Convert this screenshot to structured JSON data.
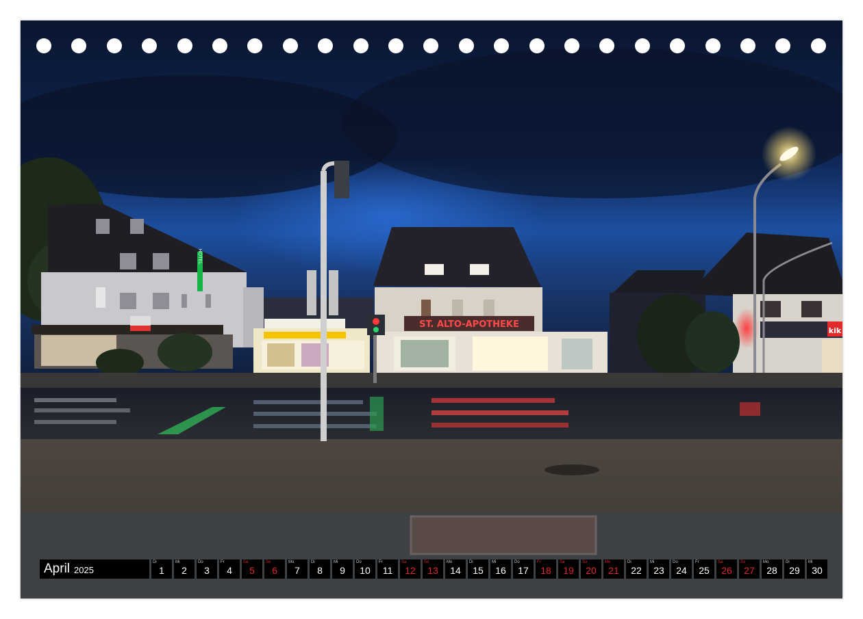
{
  "page": {
    "background": "#ffffff"
  },
  "photo": {
    "signs": {
      "pharmacy": "ST. ALTO-APOTHEKE",
      "hotel": "HOTEL",
      "kik": "kik"
    }
  },
  "binder_holes": {
    "count": 23,
    "color": "#ffffff"
  },
  "calendar": {
    "month": "April",
    "year": "2025",
    "weekend_color": "#e0262d",
    "days": [
      {
        "wd": "Di",
        "d": "1",
        "we": false
      },
      {
        "wd": "Mi",
        "d": "2",
        "we": false
      },
      {
        "wd": "Do",
        "d": "3",
        "we": false
      },
      {
        "wd": "Fr",
        "d": "4",
        "we": false
      },
      {
        "wd": "Sa",
        "d": "5",
        "we": true
      },
      {
        "wd": "So",
        "d": "6",
        "we": true
      },
      {
        "wd": "Mo",
        "d": "7",
        "we": false
      },
      {
        "wd": "Di",
        "d": "8",
        "we": false
      },
      {
        "wd": "Mi",
        "d": "9",
        "we": false
      },
      {
        "wd": "Do",
        "d": "10",
        "we": false
      },
      {
        "wd": "Fr",
        "d": "11",
        "we": false
      },
      {
        "wd": "Sa",
        "d": "12",
        "we": true
      },
      {
        "wd": "So",
        "d": "13",
        "we": true
      },
      {
        "wd": "Mo",
        "d": "14",
        "we": false
      },
      {
        "wd": "Di",
        "d": "15",
        "we": false
      },
      {
        "wd": "Mi",
        "d": "16",
        "we": false
      },
      {
        "wd": "Do",
        "d": "17",
        "we": false
      },
      {
        "wd": "Fr",
        "d": "18",
        "we": true
      },
      {
        "wd": "Sa",
        "d": "19",
        "we": true
      },
      {
        "wd": "So",
        "d": "20",
        "we": true
      },
      {
        "wd": "Mo",
        "d": "21",
        "we": true
      },
      {
        "wd": "Di",
        "d": "22",
        "we": false
      },
      {
        "wd": "Mi",
        "d": "23",
        "we": false
      },
      {
        "wd": "Do",
        "d": "24",
        "we": false
      },
      {
        "wd": "Fr",
        "d": "25",
        "we": false
      },
      {
        "wd": "Sa",
        "d": "26",
        "we": true
      },
      {
        "wd": "So",
        "d": "27",
        "we": true
      },
      {
        "wd": "Mo",
        "d": "28",
        "we": false
      },
      {
        "wd": "Di",
        "d": "29",
        "we": false
      },
      {
        "wd": "Mi",
        "d": "30",
        "we": false
      }
    ]
  }
}
